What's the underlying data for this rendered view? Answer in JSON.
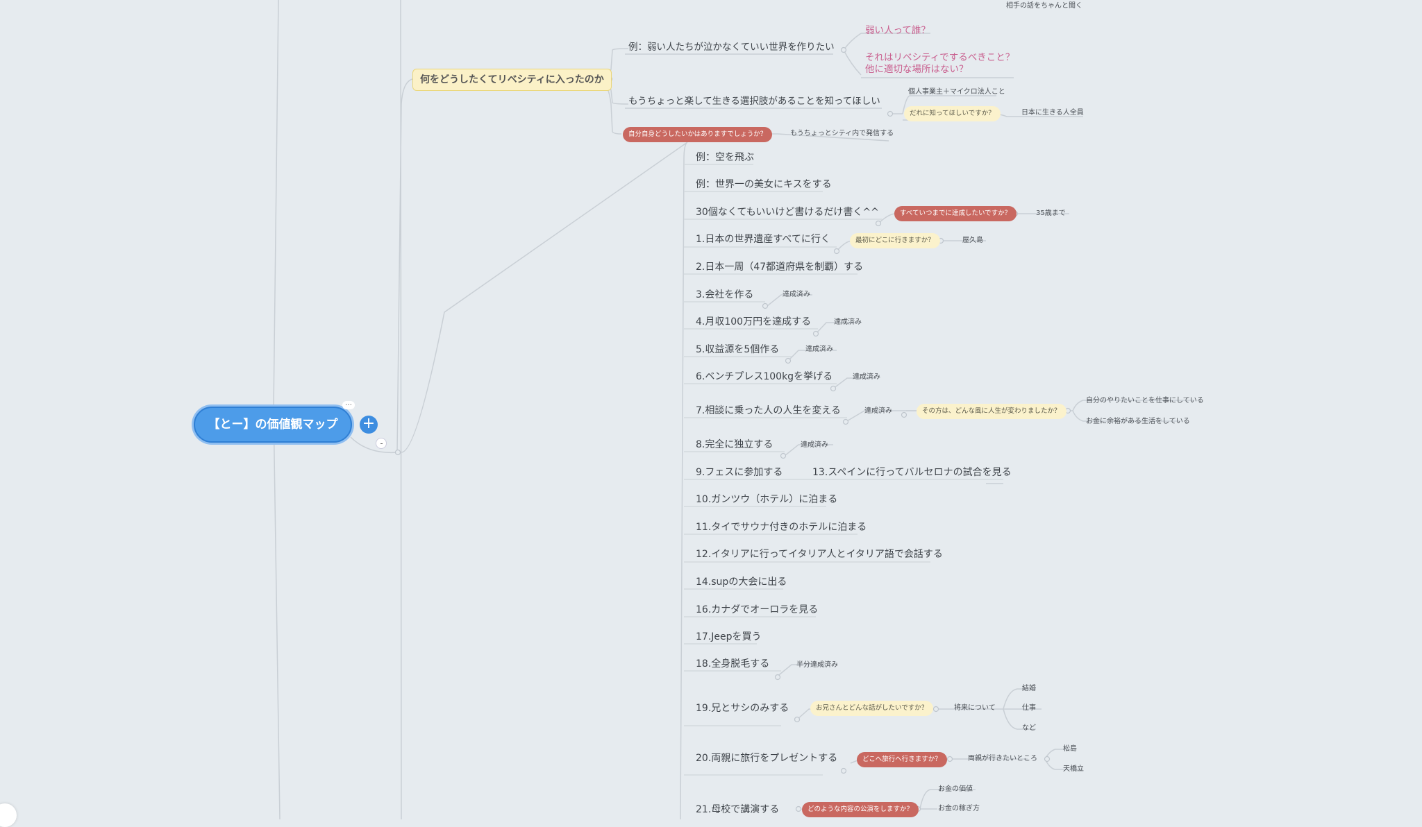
{
  "root": {
    "label": "【とー】の価値観マップ"
  },
  "controls": {
    "plus": "+",
    "more": "…"
  },
  "top_note": "相手の話をちゃんと聞く",
  "purpose": {
    "topic": "何をどうしたくてリベシティに入ったのか",
    "example": "例：弱い人たちが泣かなくていい世界を作りたい",
    "q_weak": "弱い人って誰？",
    "q_libecity": "それはリベシティでするべきこと？",
    "q_other": "他に適切な場所はない？",
    "choice": "もうちょっと楽して生きる選択肢があることを知ってほしい",
    "who_pill": "だれに知ってほしいですか？",
    "who_a": "個人事業主＋マイクロ法人こと",
    "who_b": "日本に生きる人全員",
    "self_pill": "自分自身どうしたいかはありますでしょうか？",
    "self_ans": "もうちょっとシティ内で発信する"
  },
  "bucket": {
    "ex1": "例：空を飛ぶ",
    "ex2": "例：世界一の美女にキスをする",
    "intro": "30個なくてもいいけど書けるだけ書く^^",
    "intro_pill": "すべていつまでに達成したいですか？",
    "intro_ans": "35歳まで",
    "i1": "1.日本の世界遺産すべてに行く",
    "i1_pill": "最初にどこに行きますか？",
    "i1_ans": "屋久島",
    "i2": "2.日本一周（47都道府県を制覇）する",
    "i3": "3.会社を作る",
    "i4": "4.月収100万円を達成する",
    "i5": "5.収益源を5個作る",
    "i6": "6.ベンチプレス100kgを挙げる",
    "i7": "7.相談に乗った人の人生を変える",
    "i7_pill": "その方は、どんな風に人生が変わりましたか？",
    "i7_a": "自分のやりたいことを仕事にしている",
    "i7_b": "お金に余裕がある生活をしている",
    "i8": "8.完全に独立する",
    "i9": "9.フェスに参加する",
    "i13": "13.スペインに行ってバルセロナの試合を見る",
    "i10": "10.ガンツウ（ホテル）に泊まる",
    "i11": "11.タイでサウナ付きのホテルに泊まる",
    "i12": "12.イタリアに行ってイタリア人とイタリア語で会話する",
    "i14": "14.supの大会に出る",
    "i16": "16.カナダでオーロラを見る",
    "i17": "17.Jeepを買う",
    "i18": "18.全身脱毛する",
    "i18_note": "半分達成済み",
    "i19": "19.兄とサシのみする",
    "i19_pill": "お兄さんとどんな話がしたいですか？",
    "i19_mid": "将来について",
    "i19_a": "結婚",
    "i19_b": "仕事",
    "i19_c": "など",
    "i20": "20.両親に旅行をプレゼントする",
    "i20_pill": "どこへ旅行へ行きますか？",
    "i20_mid": "両親が行きたいところ",
    "i20_a": "松島",
    "i20_b": "天橋立",
    "i21": "21.母校で講演する",
    "i21_pill": "どのような内容の公演をしますか？",
    "i21_a": "お金の価値",
    "i21_b": "お金の稼ぎ方",
    "done": "達成済み"
  },
  "colors": {
    "root": "#4d9ce9",
    "pill_red": "#c96860",
    "pill_yellow": "#fbf2cc",
    "pink_text": "#c9608f"
  }
}
